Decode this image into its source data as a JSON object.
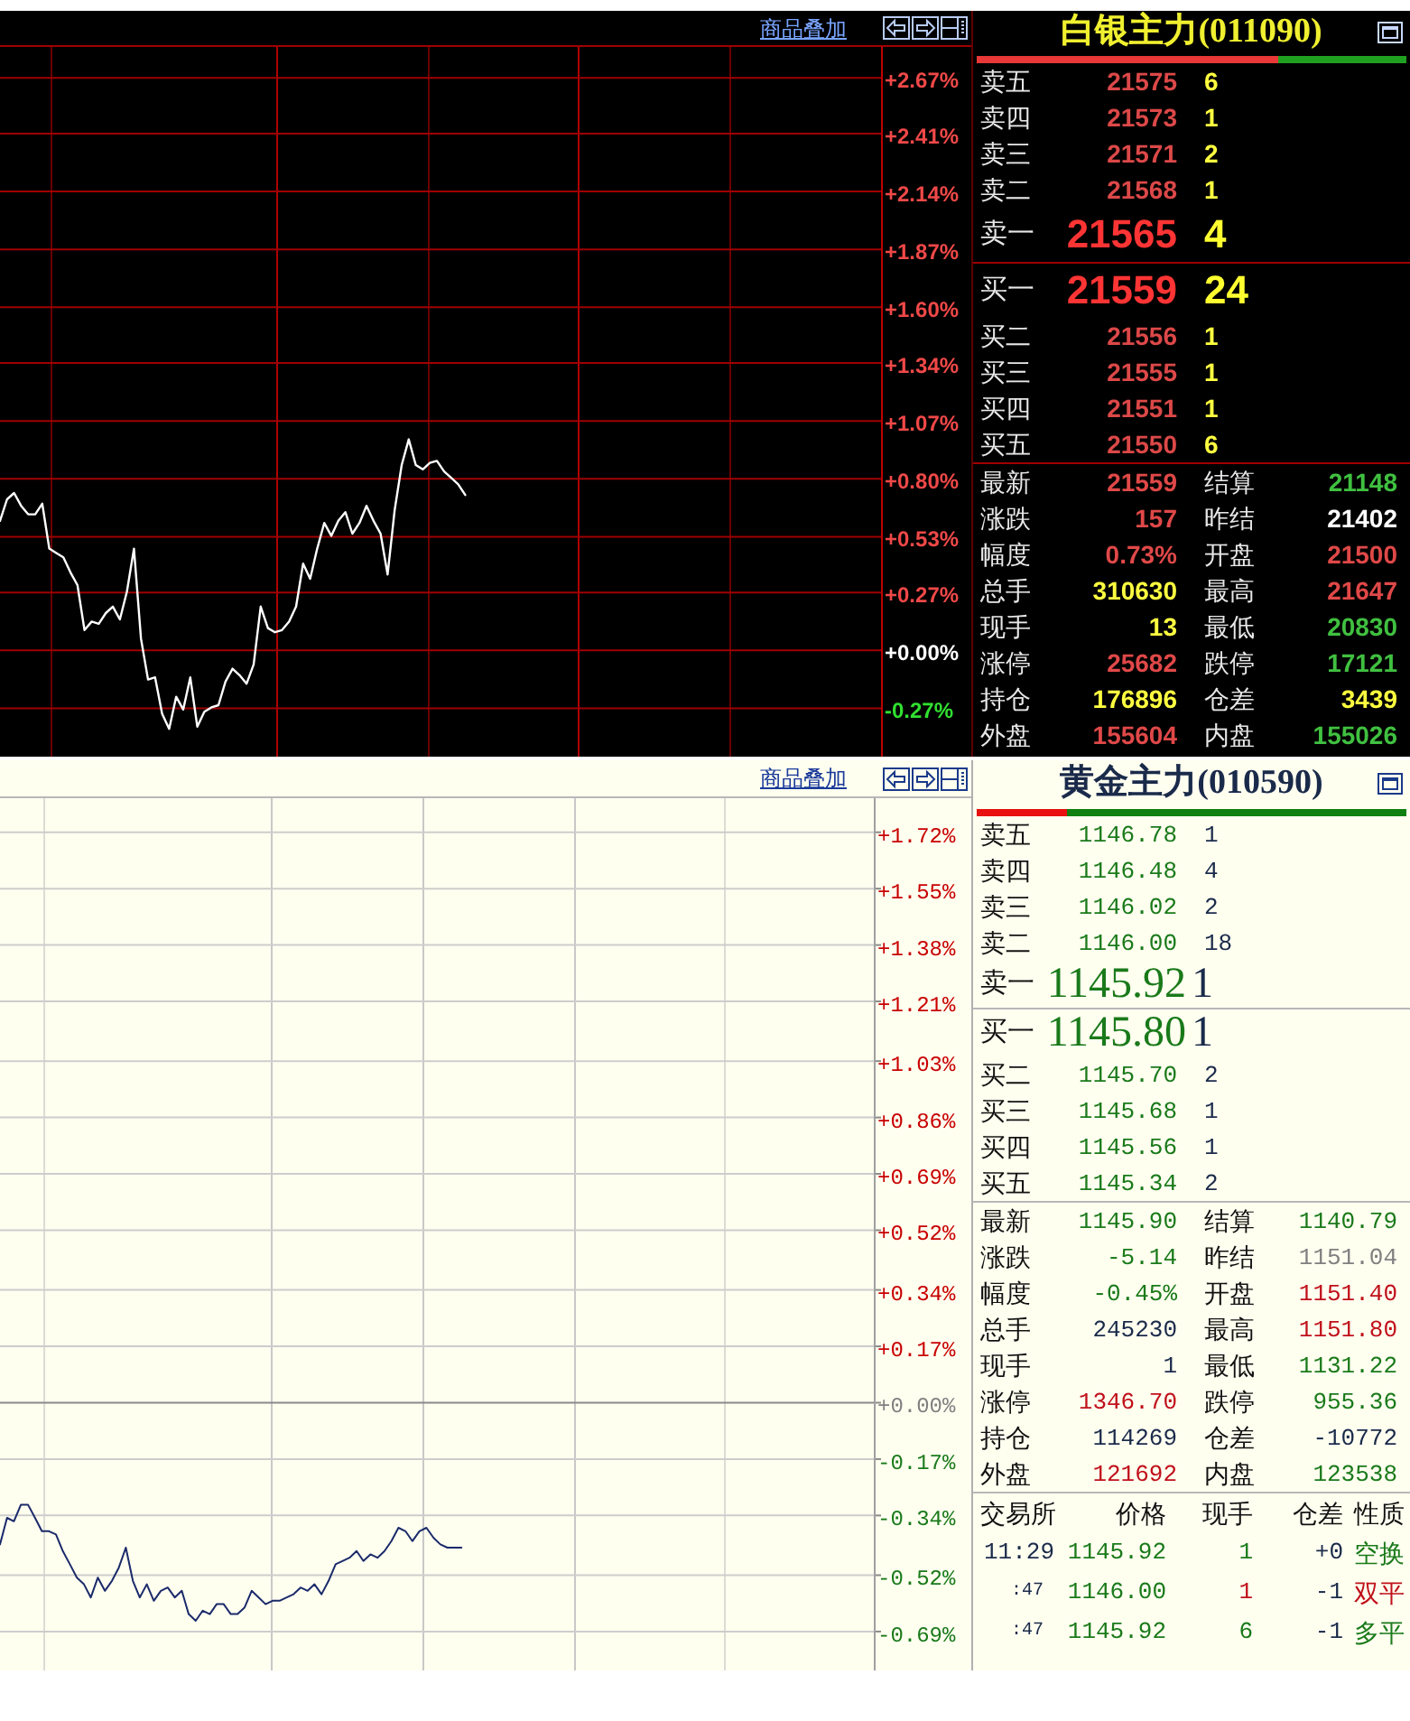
{
  "panels": [
    {
      "kind": "dark",
      "overlay_link": "商品叠加",
      "chart_data": {
        "type": "line",
        "grid": true,
        "ylim": [
          -0.5,
          2.81
        ],
        "yticks": [
          {
            "value": 2.67,
            "label": "+2.67%"
          },
          {
            "value": 2.41,
            "label": "+2.41%"
          },
          {
            "value": 2.14,
            "label": "+2.14%"
          },
          {
            "value": 1.87,
            "label": "+1.87%"
          },
          {
            "value": 1.6,
            "label": "+1.60%"
          },
          {
            "value": 1.34,
            "label": "+1.34%"
          },
          {
            "value": 1.07,
            "label": "+1.07%"
          },
          {
            "value": 0.8,
            "label": "+0.80%"
          },
          {
            "value": 0.53,
            "label": "+0.53%"
          },
          {
            "value": 0.27,
            "label": "+0.27%"
          },
          {
            "value": 0,
            "label": "+0.00%"
          },
          {
            "value": -0.27,
            "label": "-0.27%"
          }
        ],
        "series": [
          {
            "color": "#ffffff",
            "values": [
              0.6,
              0.7,
              0.73,
              0.67,
              0.63,
              0.63,
              0.68,
              0.47,
              0.45,
              0.43,
              0.36,
              0.3,
              0.09,
              0.13,
              0.12,
              0.17,
              0.2,
              0.14,
              0.27,
              0.47,
              0.05,
              -0.14,
              -0.13,
              -0.3,
              -0.37,
              -0.22,
              -0.28,
              -0.13,
              -0.36,
              -0.29,
              -0.27,
              -0.26,
              -0.15,
              -0.09,
              -0.12,
              -0.16,
              -0.07,
              0.2,
              0.1,
              0.08,
              0.09,
              0.13,
              0.2,
              0.4,
              0.33,
              0.47,
              0.59,
              0.53,
              0.6,
              0.64,
              0.54,
              0.59,
              0.67,
              0.6,
              0.54,
              0.35,
              0.65,
              0.86,
              0.98,
              0.86,
              0.84,
              0.87,
              0.88,
              0.83,
              0.8,
              0.77,
              0.72,
              null,
              null,
              null,
              null,
              null,
              null,
              null,
              null,
              null,
              null,
              null,
              null,
              null,
              null,
              null,
              null,
              null,
              null,
              null,
              null,
              null,
              null,
              null,
              null,
              null,
              null,
              null,
              null,
              null,
              null,
              null,
              null,
              null,
              null,
              null,
              null,
              null,
              null,
              null,
              null,
              null,
              null,
              null,
              null,
              null,
              null,
              null,
              null,
              null,
              null,
              null,
              null,
              null,
              null,
              null,
              null,
              null,
              null,
              null
            ]
          }
        ]
      },
      "quote": {
        "title": "白银主力(011090)",
        "ratio_bar": {
          "level": 0.7
        },
        "asks": [
          {
            "label": "卖五",
            "price": "21575",
            "volume": "6"
          },
          {
            "label": "卖四",
            "price": "21573",
            "volume": "1"
          },
          {
            "label": "卖三",
            "price": "21571",
            "volume": "2"
          },
          {
            "label": "卖二",
            "price": "21568",
            "volume": "1"
          },
          {
            "label": "卖一",
            "price": "21565",
            "volume": "4"
          }
        ],
        "bids": [
          {
            "label": "买一",
            "price": "21559",
            "volume": "24"
          },
          {
            "label": "买二",
            "price": "21556",
            "volume": "1"
          },
          {
            "label": "买三",
            "price": "21555",
            "volume": "1"
          },
          {
            "label": "买四",
            "price": "21551",
            "volume": "1"
          },
          {
            "label": "买五",
            "price": "21550",
            "volume": "6"
          }
        ],
        "stats": [
          {
            "label": "最新",
            "value": "21559",
            "color": "#e04848"
          },
          {
            "label": "结算",
            "value": "21148",
            "color": "#40c040"
          },
          {
            "label": "涨跌",
            "value": "157",
            "color": "#e04848"
          },
          {
            "label": "昨结",
            "value": "21402",
            "color": "#ffffff"
          },
          {
            "label": "幅度",
            "value": "0.73%",
            "color": "#e04848"
          },
          {
            "label": "开盘",
            "value": "21500",
            "color": "#e04848"
          },
          {
            "label": "总手",
            "value": "310630",
            "color": "#ffff40"
          },
          {
            "label": "最高",
            "value": "21647",
            "color": "#e04848"
          },
          {
            "label": "现手",
            "value": "13",
            "color": "#ffff40"
          },
          {
            "label": "最低",
            "value": "20830",
            "color": "#40c040"
          },
          {
            "label": "涨停",
            "value": "25682",
            "color": "#e04848"
          },
          {
            "label": "跌停",
            "value": "17121",
            "color": "#40c040"
          },
          {
            "label": "持仓",
            "value": "176896",
            "color": "#ffff40"
          },
          {
            "label": "仓差",
            "value": "3439",
            "color": "#ffff40"
          },
          {
            "label": "外盘",
            "value": "155604",
            "color": "#e04848"
          },
          {
            "label": "内盘",
            "value": "155026",
            "color": "#40c040"
          }
        ]
      }
    },
    {
      "kind": "light",
      "overlay_link": "商品叠加",
      "chart_data": {
        "type": "line",
        "grid": true,
        "ylim": [
          -0.81,
          1.82
        ],
        "yticks": [
          {
            "value": 1.72,
            "label": "+1.72%"
          },
          {
            "value": 1.55,
            "label": "+1.55%"
          },
          {
            "value": 1.38,
            "label": "+1.38%"
          },
          {
            "value": 1.21,
            "label": "+1.21%"
          },
          {
            "value": 1.03,
            "label": "+1.03%"
          },
          {
            "value": 0.86,
            "label": "+0.86%"
          },
          {
            "value": 0.69,
            "label": "+0.69%"
          },
          {
            "value": 0.52,
            "label": "+0.52%"
          },
          {
            "value": 0.34,
            "label": "+0.34%"
          },
          {
            "value": 0.17,
            "label": "+0.17%"
          },
          {
            "value": 0,
            "label": "+0.00%"
          },
          {
            "value": -0.17,
            "label": "-0.17%"
          },
          {
            "value": -0.34,
            "label": "-0.34%"
          },
          {
            "value": -0.52,
            "label": "-0.52%"
          },
          {
            "value": -0.69,
            "label": "-0.69%"
          }
        ],
        "series": [
          {
            "color": "#1a2a6a",
            "values": [
              -0.43,
              -0.35,
              -0.36,
              -0.31,
              -0.31,
              -0.35,
              -0.39,
              -0.39,
              -0.4,
              -0.45,
              -0.49,
              -0.53,
              -0.55,
              -0.59,
              -0.53,
              -0.57,
              -0.54,
              -0.5,
              -0.44,
              -0.54,
              -0.59,
              -0.55,
              -0.6,
              -0.57,
              -0.56,
              -0.59,
              -0.57,
              -0.64,
              -0.66,
              -0.63,
              -0.64,
              -0.61,
              -0.61,
              -0.64,
              -0.64,
              -0.62,
              -0.57,
              -0.59,
              -0.61,
              -0.6,
              -0.6,
              -0.59,
              -0.58,
              -0.56,
              -0.57,
              -0.55,
              -0.58,
              -0.54,
              -0.49,
              -0.48,
              -0.47,
              -0.45,
              -0.48,
              -0.46,
              -0.47,
              -0.45,
              -0.42,
              -0.38,
              -0.39,
              -0.42,
              -0.39,
              -0.38,
              -0.41,
              -0.43,
              -0.44,
              -0.44,
              -0.44,
              null,
              null,
              null,
              null,
              null,
              null,
              null,
              null,
              null,
              null,
              null,
              null,
              null,
              null,
              null,
              null,
              null,
              null,
              null,
              null,
              null,
              null,
              null,
              null,
              null,
              null,
              null,
              null,
              null,
              null,
              null,
              null,
              null,
              null,
              null,
              null,
              null,
              null,
              null,
              null,
              null,
              null,
              null,
              null,
              null,
              null,
              null,
              null,
              null,
              null,
              null,
              null,
              null,
              null,
              null,
              null,
              null,
              null,
              null
            ]
          }
        ]
      },
      "quote": {
        "title": "黄金主力(010590)",
        "ratio_bar": {
          "level": 0.21
        },
        "asks": [
          {
            "label": "卖五",
            "price": "1146.78",
            "volume": "1"
          },
          {
            "label": "卖四",
            "price": "1146.48",
            "volume": "4"
          },
          {
            "label": "卖三",
            "price": "1146.02",
            "volume": "2"
          },
          {
            "label": "卖二",
            "price": "1146.00",
            "volume": "18"
          },
          {
            "label": "卖一",
            "price": "1145.92",
            "volume": "1"
          }
        ],
        "bids": [
          {
            "label": "买一",
            "price": "1145.80",
            "volume": "1"
          },
          {
            "label": "买二",
            "price": "1145.70",
            "volume": "2"
          },
          {
            "label": "买三",
            "price": "1145.68",
            "volume": "1"
          },
          {
            "label": "买四",
            "price": "1145.56",
            "volume": "1"
          },
          {
            "label": "买五",
            "price": "1145.34",
            "volume": "2"
          }
        ],
        "stats": [
          {
            "label": "最新",
            "value": "1145.90",
            "color": "#1a7a1a"
          },
          {
            "label": "结算",
            "value": "1140.79",
            "color": "#1a7a1a"
          },
          {
            "label": "涨跌",
            "value": "-5.14",
            "color": "#1a7a1a"
          },
          {
            "label": "昨结",
            "value": "1151.04",
            "color": "#808080"
          },
          {
            "label": "幅度",
            "value": "-0.45%",
            "color": "#1a7a1a"
          },
          {
            "label": "开盘",
            "value": "1151.40",
            "color": "#c0101a"
          },
          {
            "label": "总手",
            "value": "245230",
            "color": "#1a2a4a"
          },
          {
            "label": "最高",
            "value": "1151.80",
            "color": "#c0101a"
          },
          {
            "label": "现手",
            "value": "1",
            "color": "#1a2a4a"
          },
          {
            "label": "最低",
            "value": "1131.22",
            "color": "#1a7a1a"
          },
          {
            "label": "涨停",
            "value": "1346.70",
            "color": "#c0101a"
          },
          {
            "label": "跌停",
            "value": "955.36",
            "color": "#1a7a1a"
          },
          {
            "label": "持仓",
            "value": "114269",
            "color": "#1a2a4a"
          },
          {
            "label": "仓差",
            "value": "-10772",
            "color": "#1a2a4a"
          },
          {
            "label": "外盘",
            "value": "121692",
            "color": "#c0101a"
          },
          {
            "label": "内盘",
            "value": "123538",
            "color": "#1a7a1a"
          }
        ],
        "trades": {
          "columns": [
            "交易所",
            "价格",
            "现手",
            "仓差",
            "性质"
          ],
          "rows": [
            {
              "time": "11:29",
              "price": "1145.92",
              "volume": "1",
              "oi_change": "+0",
              "nature": "空换",
              "color": "#1a7a1a"
            },
            {
              "time": ":47",
              "price": "1146.00",
              "volume": "1",
              "oi_change": "-1",
              "nature": "双平",
              "color": "#c0101a"
            },
            {
              "time": ":47",
              "price": "1145.92",
              "volume": "6",
              "oi_change": "-1",
              "nature": "多平",
              "color": "#1a7a1a"
            }
          ]
        }
      }
    }
  ]
}
